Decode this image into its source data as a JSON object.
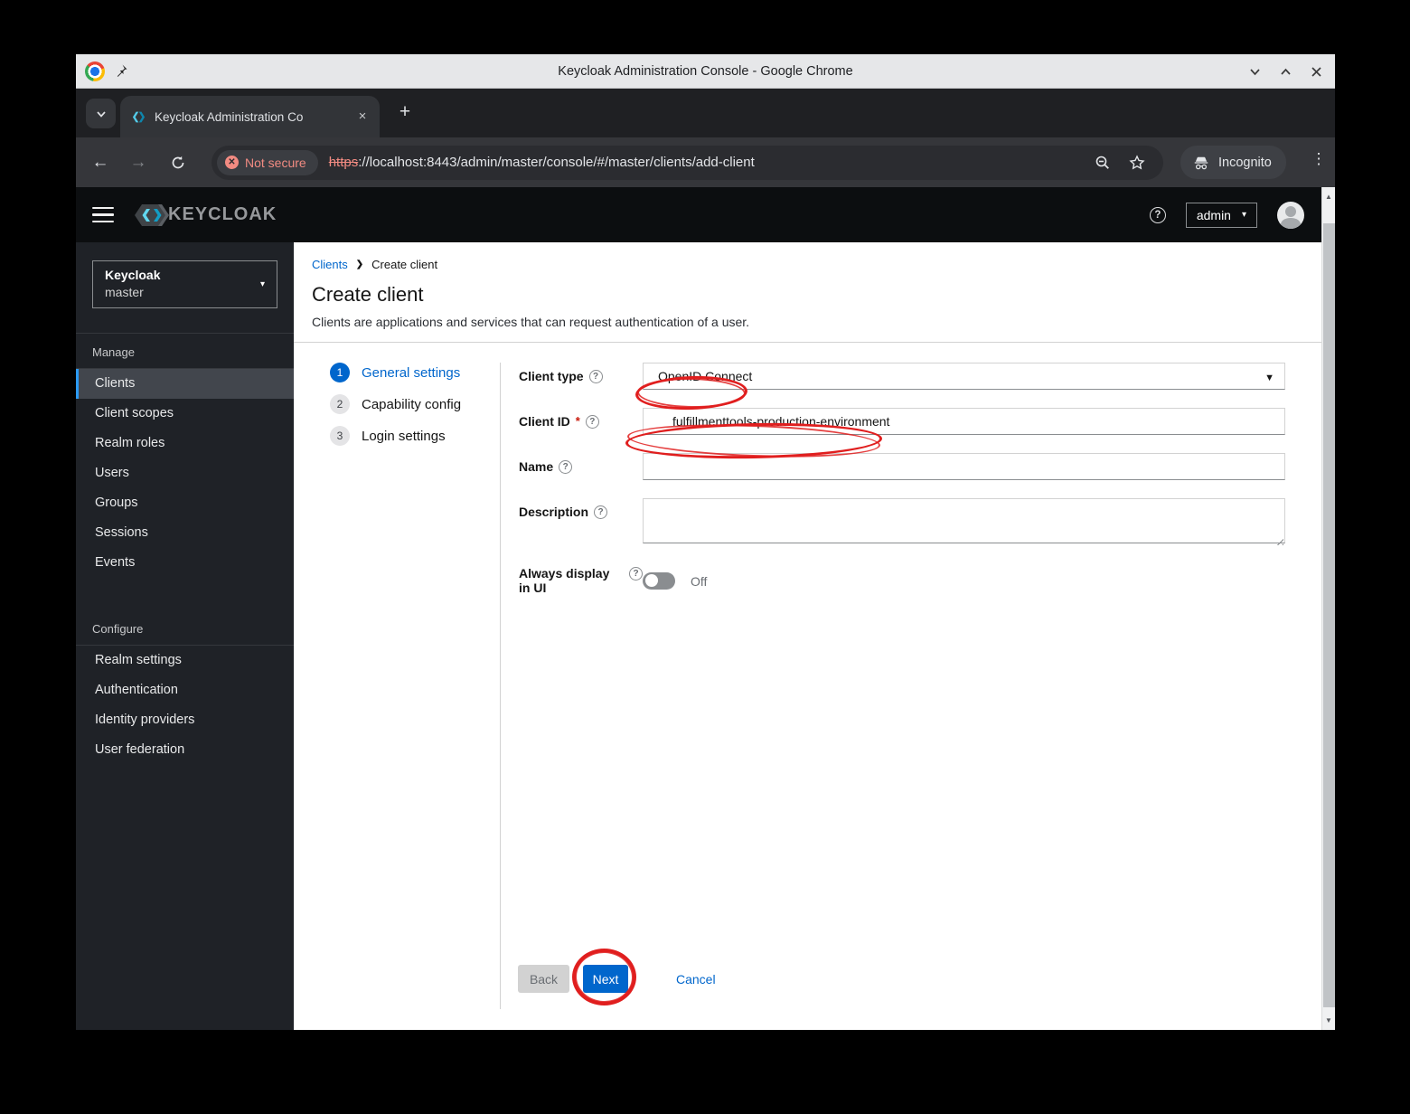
{
  "titlebar": {
    "title": "Keycloak Administration Console - Google Chrome"
  },
  "tabbar": {
    "tab_title": "Keycloak Administration Co",
    "new_tab": "+"
  },
  "addressbar": {
    "security_chip": "Not secure",
    "url_scheme": "https",
    "url_rest": "://localhost:8443/admin/master/console/#/master/clients/add-client",
    "incognito_label": "Incognito"
  },
  "kc_header": {
    "brand": "KEYCLOAK",
    "user_menu": "admin"
  },
  "sidebar": {
    "realm_name": "Keycloak",
    "realm_current": "master",
    "manage": {
      "label": "Manage",
      "items": [
        "Clients",
        "Client scopes",
        "Realm roles",
        "Users",
        "Groups",
        "Sessions",
        "Events"
      ]
    },
    "configure": {
      "label": "Configure",
      "items": [
        "Realm settings",
        "Authentication",
        "Identity providers",
        "User federation"
      ]
    }
  },
  "page": {
    "breadcrumb_parent": "Clients",
    "breadcrumb_current": "Create client",
    "title": "Create client",
    "subtitle": "Clients are applications and services that can request authentication of a user."
  },
  "wizard": {
    "steps": [
      {
        "num": "1",
        "label": "General settings"
      },
      {
        "num": "2",
        "label": "Capability config"
      },
      {
        "num": "3",
        "label": "Login settings"
      }
    ]
  },
  "form": {
    "client_type_label": "Client type",
    "client_type_value": "OpenID Connect",
    "client_id_label": "Client ID",
    "client_id_required": "*",
    "client_id_value": "fulfillmenttools-production-environment",
    "name_label": "Name",
    "description_label": "Description",
    "always_display_label": "Always display in UI",
    "toggle_state": "Off"
  },
  "actions": {
    "back": "Back",
    "next": "Next",
    "cancel": "Cancel"
  },
  "colors": {
    "accent_blue": "#0066cc",
    "nav_active_blue": "#2b9af3",
    "annotation_red": "#e01e1e",
    "not_secure_red": "#f28b82"
  }
}
